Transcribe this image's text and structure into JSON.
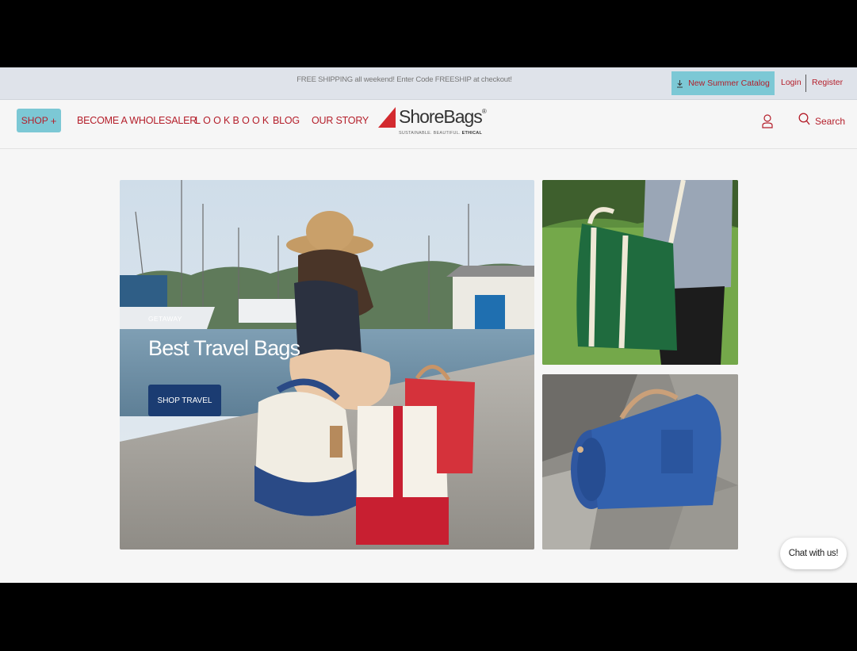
{
  "promo": {
    "text": "FREE SHIPPING all weekend! Enter Code FREESHIP at checkout!",
    "catalog_label": "New Summer Catalog",
    "login_label": "Login",
    "register_label": "Register"
  },
  "nav": {
    "shop_label": "SHOP",
    "shop_plus": "+",
    "items": [
      {
        "label": "BECOME A WHOLESALER"
      },
      {
        "label": "LOOKBOOK"
      },
      {
        "label": "BLOG"
      },
      {
        "label": "OUR STORY"
      }
    ],
    "search_label": "Search"
  },
  "logo": {
    "name": "ShoreBags",
    "mark": "®",
    "tagline_light": "SUSTAINABLE. BEAUTIFUL.",
    "tagline_bold": "ETHICAL"
  },
  "hero": {
    "eyebrow": "GETAWAY",
    "title": "Best Travel Bags",
    "cta_label": "SHOP TRAVEL"
  },
  "chat": {
    "label": "Chat with us!"
  },
  "colors": {
    "accent_red": "#b41e2a",
    "accent_teal": "#7cc8d5",
    "cta_navy": "#1b3c72"
  },
  "icons": {
    "account": "account-icon",
    "search": "search-icon",
    "download": "download-icon",
    "logo_mark": "sail-logo-icon"
  }
}
